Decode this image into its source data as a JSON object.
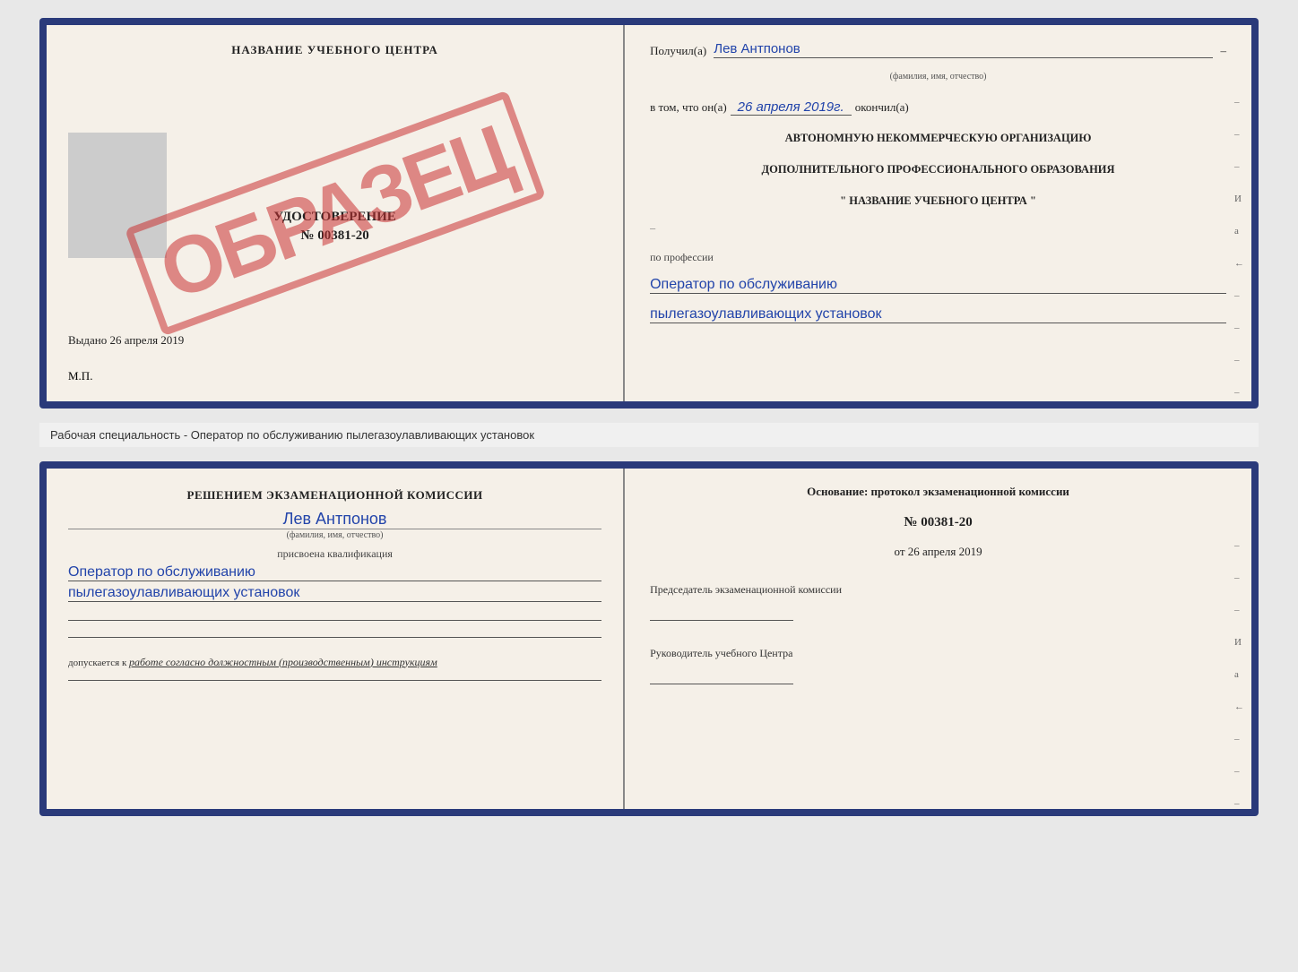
{
  "top_doc": {
    "left": {
      "school_name": "НАЗВАНИЕ УЧЕБНОГО ЦЕНТРА",
      "cert_type": "УДОСТОВЕРЕНИЕ",
      "cert_number": "№ 00381-20",
      "issued_label": "Выдано",
      "issued_date": "26 апреля 2019",
      "mp_label": "М.П."
    },
    "stamp": "ОБРАЗЕЦ",
    "right": {
      "received_label": "Получил(а)",
      "person_name": "Лев Антпонов",
      "name_subtext": "(фамилия, имя, отчество)",
      "in_that_label": "в том, что он(а)",
      "date_value": "26 апреля 2019г.",
      "finished_label": "окончил(а)",
      "org_line1": "АВТОНОМНУЮ НЕКОММЕРЧЕСКУЮ ОРГАНИЗАЦИЮ",
      "org_line2": "ДОПОЛНИТЕЛЬНОГО ПРОФЕССИОНАЛЬНОГО ОБРАЗОВАНИЯ",
      "org_line3": "\"   НАЗВАНИЕ УЧЕБНОГО ЦЕНТРА   \"",
      "profession_label": "по профессии",
      "profession_line1": "Оператор по обслуживанию",
      "profession_line2": "пылегазоулавливающих установок"
    }
  },
  "separator": {
    "text": "Рабочая специальность - Оператор по обслуживанию пылегазоулавливающих установок"
  },
  "bottom_doc": {
    "left": {
      "decision_line1": "Решением экзаменационной комиссии",
      "person_name": "Лев Антпонов",
      "name_subtext": "(фамилия, имя, отчество)",
      "qualification_label": "присвоена квалификация",
      "qualification_line1": "Оператор по обслуживанию",
      "qualification_line2": "пылегазоулавливающих установок",
      "allowed_label": "допускается к",
      "allowed_value": "работе согласно должностным (производственным) инструкциям"
    },
    "right": {
      "basis_label": "Основание: протокол экзаменационной комиссии",
      "protocol_number": "№ 00381-20",
      "protocol_date_prefix": "от",
      "protocol_date": "26 апреля 2019",
      "chairman_label": "Председатель экзаменационной комиссии",
      "head_label": "Руководитель учебного Центра"
    }
  },
  "side_marks": {
    "items": [
      "–",
      "–",
      "–",
      "И",
      "а",
      "←",
      "–",
      "–",
      "–",
      "–"
    ]
  }
}
